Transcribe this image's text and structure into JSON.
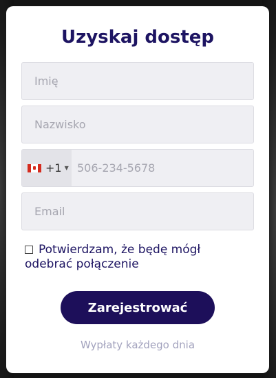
{
  "form": {
    "title": "Uzyskaj dostęp",
    "first_name_placeholder": "Imię",
    "last_name_placeholder": "Nazwisko",
    "phone": {
      "country_flag_icon": "canada-flag-icon",
      "dial_code": "+1",
      "placeholder": "506-234-5678"
    },
    "email_placeholder": "Email",
    "consent_text": "Potwierdzam, że będę mógł odebrać połączenie",
    "consent_checked": false,
    "submit_label": "Zarejestrować",
    "footer_note": "Wypłaty każdego dnia"
  },
  "colors": {
    "title": "#1d1462",
    "button_bg": "#1d0f5a",
    "field_bg": "#efeff3",
    "footer": "#a2a2bd"
  }
}
